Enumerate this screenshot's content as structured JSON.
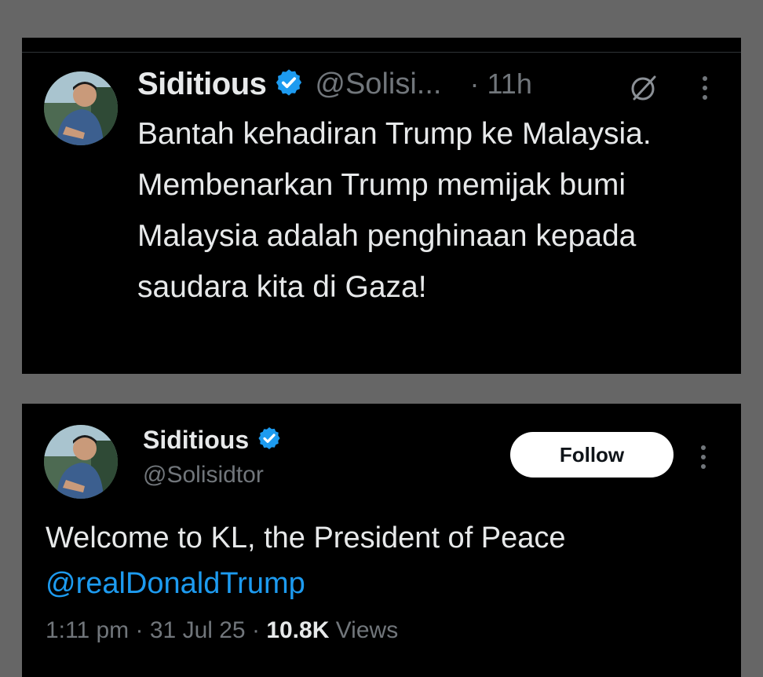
{
  "post1": {
    "display_name": "Siditious",
    "handle": "@Solisi...",
    "meta": "· 11h",
    "text": "Bantah kehadiran Trump ke Malaysia. Membenarkan Trump memijak bumi Malaysia adalah penghinaan kepada saudara kita di Gaza!",
    "icons": {
      "verified": "verified-badge-icon",
      "grok": "grok-icon",
      "more": "more-vertical-icon"
    }
  },
  "post2": {
    "display_name": "Siditious",
    "handle": "@Solisidtor",
    "follow_label": "Follow",
    "text": "Welcome to KL, the President of Peace",
    "mention": "@realDonaldTrump",
    "time": "1:11 pm",
    "date": "31 Jul 25",
    "separator": "·",
    "views_count": "10.8K",
    "views_label": "Views",
    "icons": {
      "verified": "verified-badge-icon",
      "more": "more-vertical-icon"
    }
  },
  "colors": {
    "page_bg": "#666666",
    "card_bg": "#000000",
    "text": "#e7e9ea",
    "muted": "#71767b",
    "link": "#1d9bf0",
    "verified": "#1d9bf0",
    "follow_bg": "#ffffff"
  }
}
